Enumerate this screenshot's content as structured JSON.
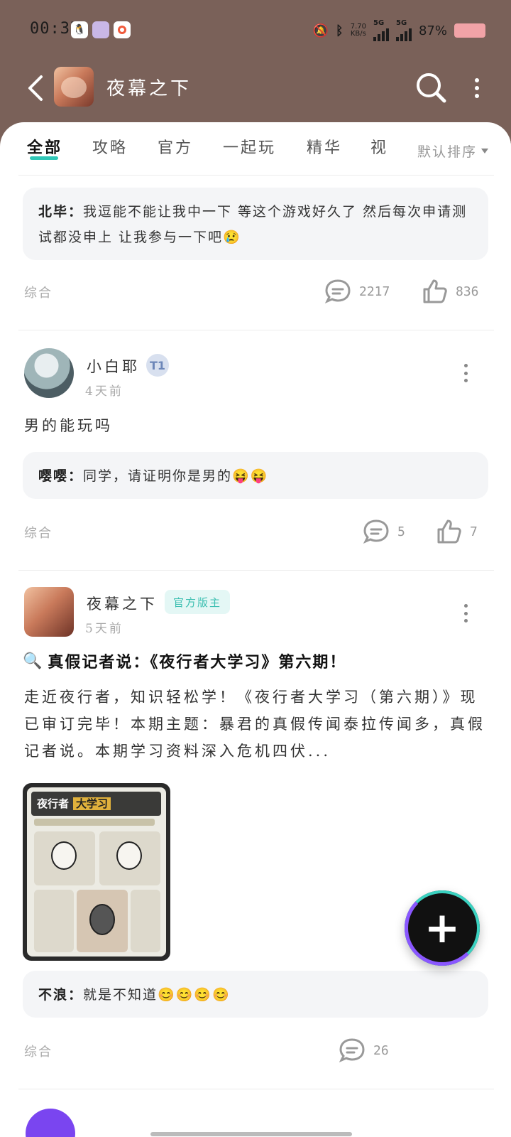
{
  "status_bar": {
    "time": "00:37",
    "net_speed_top": "7.70",
    "net_speed_unit": "KB/s",
    "sig1": "5G",
    "sig2": "5G",
    "battery": "87%"
  },
  "header": {
    "title": "夜幕之下"
  },
  "tabs": [
    "全部",
    "攻略",
    "官方",
    "一起玩",
    "精华",
    "视"
  ],
  "sort_label": "默认排序",
  "posts": [
    {
      "comment": {
        "author": "北毕：",
        "text": "我逗能不能让我中一下 等这个游戏好久了 然后每次申请测试都没申上 让我参与一下吧😢"
      },
      "tag": "综合",
      "comments": "2217",
      "likes": "836"
    },
    {
      "author": "小白耶",
      "level": "T1",
      "time": "4天前",
      "body": "男的能玩吗",
      "comment": {
        "author": "嘤嘤：",
        "text": "同学，请证明你是男的😝😝"
      },
      "tag": "综合",
      "comments": "5",
      "likes": "7"
    },
    {
      "author": "夜幕之下",
      "badge": "官方版主",
      "time": "5天前",
      "title": "真假记者说：《夜行者大学习》第六期！",
      "body": "走近夜行者，知识轻松学！《夜行者大学习（第六期）》现已审订完毕！本期主题：暴君的真假传闻泰拉传闻多，真假记者说。本期学习资料深入危机四伏...",
      "image": {
        "title_a": "夜行者",
        "title_b": "大学习"
      },
      "comment": {
        "author": "不浪：",
        "text": "就是不知道😊😊😊😊"
      },
      "tag": "综合",
      "comments": "26"
    }
  ],
  "fab_label": "+",
  "colors": {
    "accent": "#30c7b7",
    "header_bg": "#7a6159",
    "badge_bg": "#e4f7f5"
  }
}
